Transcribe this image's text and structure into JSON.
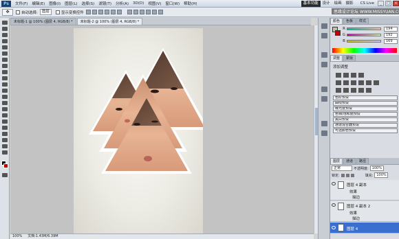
{
  "menubar": {
    "app_icon": "Ps",
    "items": [
      "文件(F)",
      "编辑(E)",
      "图像(I)",
      "图层(L)",
      "选择(S)",
      "滤镜(T)",
      "分析(A)",
      "3D(D)",
      "视图(V)",
      "窗口(W)",
      "帮助(H)"
    ],
    "workspace": [
      "基本功能",
      "设计",
      "绘画",
      "摄影"
    ],
    "search_label": "CS Live"
  },
  "options": {
    "auto_select_label": "自动选择:",
    "auto_select_value": "图层",
    "transform_label": "显示变换控件"
  },
  "tabs": [
    {
      "label": "未标题-1 @ 100% (图层 4, RGB/8) *",
      "active": false
    },
    {
      "label": "未标题-2 @ 100% (图层 4, RGB/8) *",
      "active": true
    }
  ],
  "statusbar": {
    "zoom": "100%",
    "doc": "文档:1.43M/6.39M"
  },
  "color_panel": {
    "tabs": [
      "颜色",
      "色板",
      "样式"
    ],
    "r_label": "R",
    "r": "194",
    "g_label": "G",
    "g": "192",
    "b_label": "B",
    "b": "169"
  },
  "adjust_panel": {
    "tabs": [
      "调整",
      "蒙版"
    ],
    "title": "添加调整",
    "presets": [
      "色阶预设",
      "曲线预设",
      "曝光度预设",
      "色相/饱和度预设",
      "黑白预设",
      "通道混合器预设",
      "可选颜色预设"
    ]
  },
  "layers_panel": {
    "tabs": [
      "图层",
      "通道",
      "路径"
    ],
    "blend_mode": "正常",
    "opacity_label": "不透明度:",
    "opacity": "100%",
    "lock_label": "锁定:",
    "fill_label": "填充:",
    "fill": "100%",
    "layers": [
      {
        "name": "图层 4 副本",
        "sub": "效果",
        "sub2": "描边"
      },
      {
        "name": "图层 4 副本 2",
        "sub": "效果",
        "sub2": "描边"
      },
      {
        "name": "图层 4",
        "selected": true
      }
    ]
  },
  "watermark": "思缘设计论坛 WWW.MISSYUAN.COM",
  "colors": {
    "selection": "#3a6fd0",
    "accent": "#1c3f6e"
  }
}
